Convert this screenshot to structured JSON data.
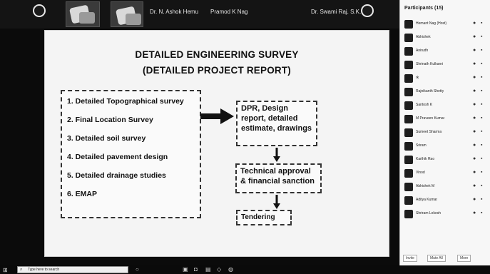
{
  "meeting": {
    "participants": [
      {
        "name": "Dr. N. Ashok Hemu"
      },
      {
        "name": "Pramod K Nag"
      },
      {
        "name": "Dr. Swami Raj. S.K."
      }
    ]
  },
  "slide": {
    "title_line1": "DETAILED ENGINEERING SURVEY",
    "title_line2": "(DETAILED PROJECT REPORT)",
    "steps": [
      "1. Detailed Topographical survey",
      "2. Final Location Survey",
      "3. Detailed soil survey",
      "4. Detailed pavement design",
      "5. Detailed drainage studies",
      "6. EMAP"
    ],
    "flow": {
      "box1": "DPR, Design report, detailed estimate, drawings",
      "box2": "Technical approval & financial sanction",
      "box3": "Tendering"
    }
  },
  "panel": {
    "title": "Participants (15)",
    "participants": [
      {
        "name": "Hemant Nag (Host)"
      },
      {
        "name": "Abhishek"
      },
      {
        "name": "Anirudh"
      },
      {
        "name": "Shrinath Kulkarni"
      },
      {
        "name": "rk"
      },
      {
        "name": "Rajnikanth Shetty"
      },
      {
        "name": "Santosh K"
      },
      {
        "name": "M Praveen Kumar"
      },
      {
        "name": "Sumeet Sharma"
      },
      {
        "name": "Sriram"
      },
      {
        "name": "Karthik Rao"
      },
      {
        "name": "Vinod"
      },
      {
        "name": "Abhishek M"
      },
      {
        "name": "Aditya Kumar"
      },
      {
        "name": "Shriram Lokesh"
      }
    ],
    "buttons": [
      "Invite",
      "Mute All",
      "More"
    ]
  },
  "taskbar": {
    "search_text": "Type here to search"
  }
}
